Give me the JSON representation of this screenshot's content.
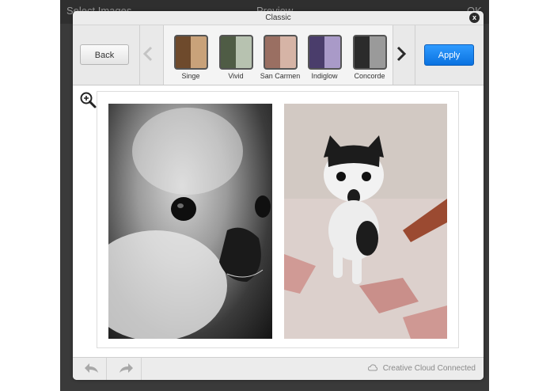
{
  "background_screen": {
    "left": "Select Images",
    "title": "Preview",
    "right": "OK"
  },
  "dialog": {
    "title": "Classic",
    "close_label": "x"
  },
  "toolbar": {
    "back_label": "Back",
    "apply_label": "Apply",
    "prev_icon": "chevron-left",
    "next_icon": "chevron-right"
  },
  "filters": [
    {
      "name": "Singe",
      "colors": [
        "#6e4a2c",
        "#c9a27a"
      ]
    },
    {
      "name": "Vivid",
      "colors": [
        "#4f5c45",
        "#b7c2b0"
      ]
    },
    {
      "name": "San Carmen",
      "colors": [
        "#9a6f62",
        "#d6b4a6"
      ]
    },
    {
      "name": "Indiglow",
      "colors": [
        "#4a3d6b",
        "#a99ac8"
      ]
    },
    {
      "name": "Concorde",
      "colors": [
        "#2b2b2b",
        "#9a9a9a"
      ]
    }
  ],
  "zoom_icon": "zoom-in",
  "footer": {
    "undo_icon": "undo-arrow",
    "redo_icon": "redo-arrow",
    "status": "Creative Cloud Connected"
  },
  "colors": {
    "apply": "#1a82f0",
    "backdrop": "#3a3a3a"
  }
}
